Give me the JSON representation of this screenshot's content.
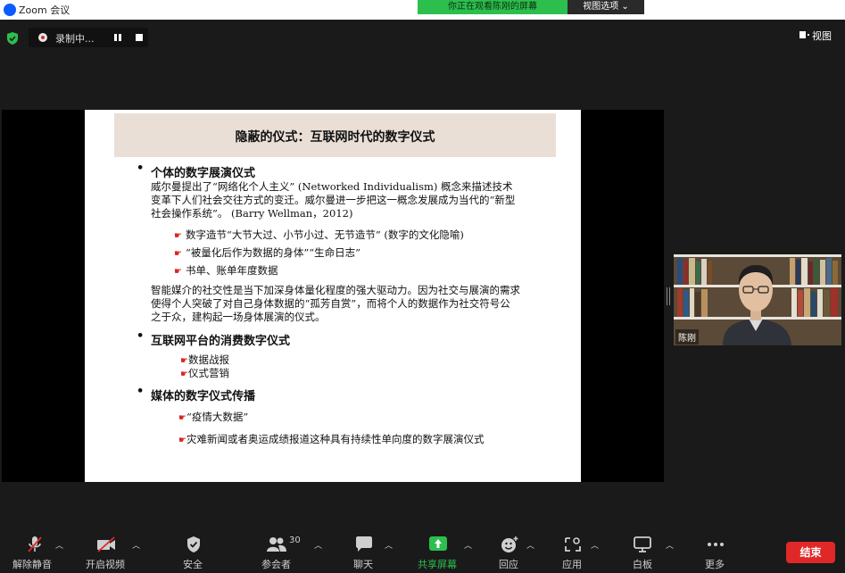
{
  "window": {
    "title": "Zoom 会议"
  },
  "banner": {
    "message": "你正在观看陈刚的屏幕",
    "options_label": "视图选项 ⌄"
  },
  "recording": {
    "label": "录制中..."
  },
  "view_button": {
    "label": "视图"
  },
  "slide": {
    "title": "隐蔽的仪式：互联网时代的数字仪式",
    "sections": [
      {
        "heading": "个体的数字展演仪式",
        "paragraph_lines": [
          "威尔曼提出了“网络化个人主义” (Networked Individualism) 概念来描述技术",
          "变革下人们社会交往方式的变迁。威尔曼进一步把这一概念发展成为当代的“新型",
          "社会操作系统”。 (Barry Wellman，2012)"
        ],
        "items": [
          "数字造节“大节大过、小节小过、无节造节” (数字的文化隐喻)",
          "“被量化后作为数据的身体”“生命日志”",
          "书单、账单年度数据"
        ],
        "closing_lines": [
          "智能媒介的社交性是当下加深身体量化程度的强大驱动力。因为社交与展演的需求",
          "使得个人突破了对自己身体数据的“孤芳自赏”，而将个人的数据作为社交符号公",
          "之于众，建构起一场身体展演的仪式。"
        ]
      },
      {
        "heading": "互联网平台的消费数字仪式",
        "items": [
          "数据战报",
          "仪式营销"
        ]
      },
      {
        "heading": "媒体的数字仪式传播",
        "items": [
          "“疫情大数据”",
          "灾难新闻或者奥运成绩报道这种具有持续性单向度的数字展演仪式"
        ]
      }
    ]
  },
  "participant": {
    "name": "陈刚"
  },
  "toolbar": {
    "unmute": "解除静音",
    "start_video": "开启视频",
    "security": "安全",
    "participants": "参会者",
    "participants_count": "30",
    "chat": "聊天",
    "share_screen": "共享屏幕",
    "reactions": "回应",
    "apps": "应用",
    "whiteboard": "白板",
    "more": "更多",
    "end": "结束"
  },
  "colors": {
    "accent_green": "#2dbf4e",
    "end_red": "#e02828",
    "slide_title_bg": "#e9dfd7",
    "bullet_hand": "#dd2222"
  }
}
